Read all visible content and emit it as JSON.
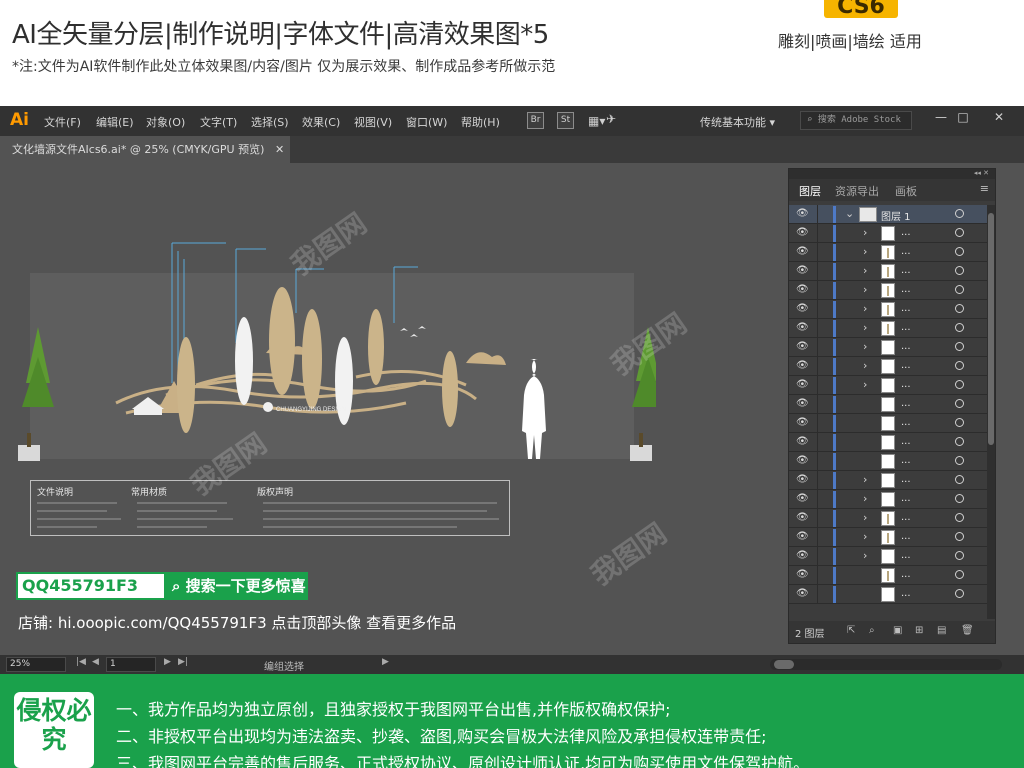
{
  "banner": {
    "title": "AI全矢量分层|制作说明|字体文件|高清效果图*5",
    "note": "*注:文件为AI软件制作此处立体效果图/内容/图片 仅为展示效果、制作成品参考所做示范",
    "version_badge": "CS6",
    "tags": "雕刻|喷画|墙绘 适用"
  },
  "app": {
    "logo": "Ai",
    "menu": [
      "文件(F)",
      "编辑(E)",
      "对象(O)",
      "文字(T)",
      "选择(S)",
      "效果(C)",
      "视图(V)",
      "窗口(W)",
      "帮助(H)"
    ],
    "bridge_icon": "Br",
    "stock_icon": "St",
    "workspace": "传统基本功能 ▾",
    "stock_search_placeholder": "搜索 Adobe Stock",
    "window_controls": [
      "—",
      "□",
      "✕"
    ]
  },
  "document": {
    "tab_label": "文化墙源文件AIcs6.ai* @ 25% (CMYK/GPU 预览)",
    "close": "✕"
  },
  "artwork": {
    "brand_text": "CHUANGYIJING DESIGN",
    "info_headers": [
      "文件说明",
      "常用材质",
      "版权声明"
    ]
  },
  "promo": {
    "qq": "QQ455791F3",
    "search_button": "搜索一下更多惊喜",
    "shop_line": "店铺: hi.ooopic.com/QQ455791F3  点击顶部头像 查看更多作品"
  },
  "statusbar": {
    "zoom": "25%",
    "artboard": "1",
    "status_text": "编组选择"
  },
  "layers_panel": {
    "tabs": [
      "图层",
      "资源导出",
      "画板"
    ],
    "menu_icon": "≡",
    "top_layer_name": "图层 1",
    "sublayer_label": "...",
    "rows": [
      {
        "chevron": true,
        "tall_thumb": false
      },
      {
        "chevron": true,
        "tall_thumb": true
      },
      {
        "chevron": true,
        "tall_thumb": true
      },
      {
        "chevron": true,
        "tall_thumb": true
      },
      {
        "chevron": true,
        "tall_thumb": true
      },
      {
        "chevron": true,
        "tall_thumb": true
      },
      {
        "chevron": true,
        "tall_thumb": false
      },
      {
        "chevron": true,
        "tall_thumb": false
      },
      {
        "chevron": true,
        "tall_thumb": false
      },
      {
        "chevron": false,
        "tall_thumb": false
      },
      {
        "chevron": false,
        "tall_thumb": false
      },
      {
        "chevron": false,
        "tall_thumb": false
      },
      {
        "chevron": false,
        "tall_thumb": false
      },
      {
        "chevron": true,
        "tall_thumb": false
      },
      {
        "chevron": true,
        "tall_thumb": false
      },
      {
        "chevron": true,
        "tall_thumb": true
      },
      {
        "chevron": true,
        "tall_thumb": true
      },
      {
        "chevron": true,
        "tall_thumb": false
      },
      {
        "chevron": false,
        "tall_thumb": true
      },
      {
        "chevron": false,
        "tall_thumb": false
      }
    ],
    "footer_count": "2 图层"
  },
  "notice": {
    "badge": "侵权必究",
    "lines": [
      "一、我方作品均为独立原创，且独家授权于我图网平台出售,并作版权确权保护;",
      "二、非授权平台出现均为违法盗卖、抄袭、盗图,购买会冒极大法律风险及承担侵权连带责任;",
      "三、我图网平台完善的售后服务、正式授权协议、原创设计师认证,均可为购买使用文件保驾护航。"
    ]
  },
  "watermark_text": "我图网"
}
